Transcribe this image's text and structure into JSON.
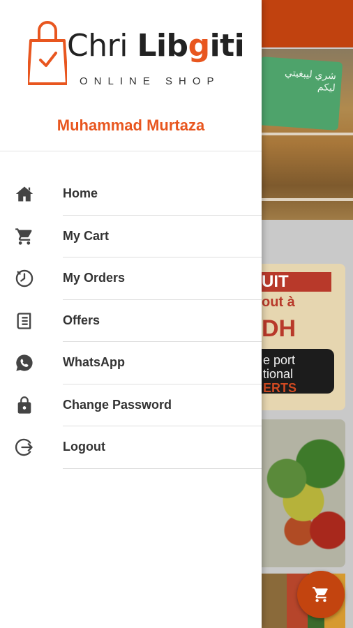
{
  "app": {
    "brand_part1": "Chri",
    "brand_part2_pre": "Lib",
    "brand_part2_g": "g",
    "brand_part2_post": "iti",
    "brand_tagline": "ONLINE SHOP",
    "accent_color": "#e8561f"
  },
  "user": {
    "name": "Muhammad Murtaza"
  },
  "menu": {
    "items": [
      {
        "label": "Home",
        "icon": "home-icon"
      },
      {
        "label": "My Cart",
        "icon": "cart-icon"
      },
      {
        "label": "My Orders",
        "icon": "orders-clock-icon"
      },
      {
        "label": "Offers",
        "icon": "offers-list-icon"
      },
      {
        "label": "WhatsApp",
        "icon": "whatsapp-icon"
      },
      {
        "label": "Change Password",
        "icon": "lock-icon"
      },
      {
        "label": "Logout",
        "icon": "logout-icon"
      }
    ]
  },
  "background": {
    "sign_text": "شري ليبغيتي ليكم",
    "promo_line1": "UIT",
    "promo_line2": "out à",
    "promo_line3": "DH",
    "promo_box_line1": "e port",
    "promo_box_line2": "tional",
    "promo_box_line3": "ERTS"
  },
  "cart_fab": {
    "icon": "cart-icon"
  }
}
